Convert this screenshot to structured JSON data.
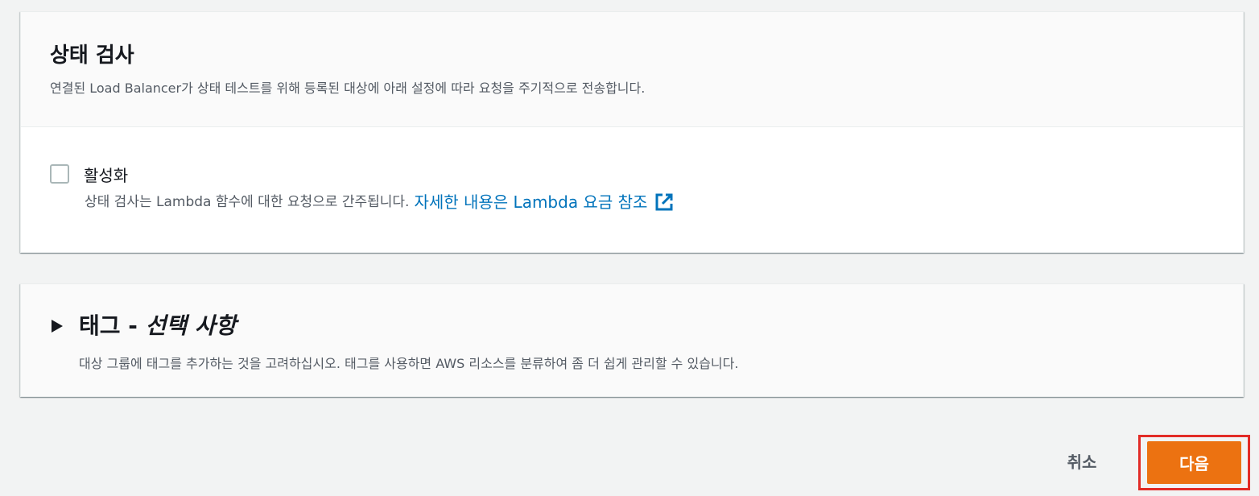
{
  "health_check": {
    "title": "상태 검사",
    "description": "연결된 Load Balancer가 상태 테스트를 위해 등록된 대상에 아래 설정에 따라 요청을 주기적으로 전송합니다.",
    "enable_label": "활성화",
    "enable_checked": false,
    "note": "상태 검사는 Lambda 함수에 대한 요청으로 간주됩니다.",
    "link_text": "자세한 내용은 Lambda 요금 참조",
    "link_icon": "external-link-icon"
  },
  "tags": {
    "title_prefix": "태그 -",
    "title_optional": "선택 사항",
    "description": "대상 그룹에 태그를 추가하는 것을 고려하십시오. 태그를 사용하면 AWS 리소스를 분류하여 좀 더 쉽게 관리할 수 있습니다.",
    "expand_icon": "caret-right-icon"
  },
  "footer": {
    "cancel_label": "취소",
    "next_label": "다음"
  },
  "colors": {
    "primary_button": "#ec7211",
    "link": "#0073bb",
    "highlight": "#e22b26"
  }
}
